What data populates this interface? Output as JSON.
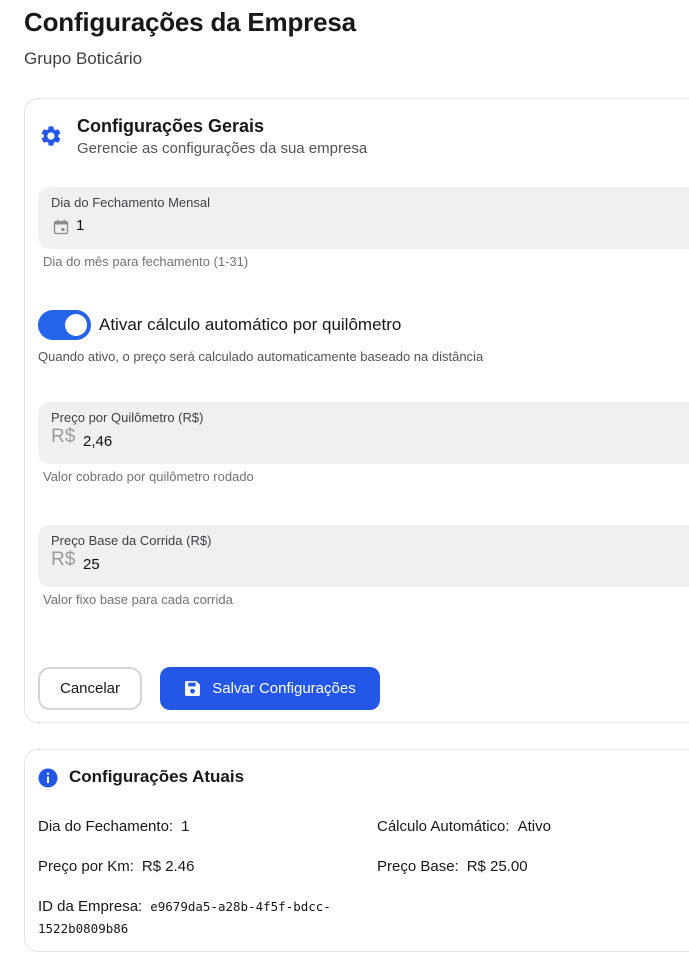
{
  "page": {
    "title": "Configurações da Empresa",
    "subtitle": "Grupo Boticário"
  },
  "general": {
    "icon": "gear-icon",
    "title": "Configurações Gerais",
    "description": "Gerencie as configurações da sua empresa",
    "closing_day": {
      "label": "Dia do Fechamento Mensal",
      "value": "1",
      "icon": "calendar-icon",
      "help": "Dia do mês para fechamento (1-31)"
    },
    "auto_calc": {
      "enabled": true,
      "label": "Ativar cálculo automático por quilômetro",
      "help": "Quando ativo, o preço será calculado automaticamente baseado na distância"
    },
    "price_per_km": {
      "label": "Preço por Quilômetro (R$)",
      "prefix": "R$",
      "value": "2,46",
      "help": "Valor cobrado por quilômetro rodado"
    },
    "base_price": {
      "label": "Preço Base da Corrida (R$)",
      "prefix": "R$",
      "value": "25",
      "help": "Valor fixo base para cada corrida"
    },
    "buttons": {
      "cancel": "Cancelar",
      "save": "Salvar Configurações"
    }
  },
  "current": {
    "icon": "info-icon",
    "title": "Configurações Atuais",
    "closing_day_label": "Dia do Fechamento:",
    "closing_day_value": "1",
    "auto_calc_label": "Cálculo Automático:",
    "auto_calc_value": "Ativo",
    "price_km_label": "Preço por Km:",
    "price_km_value": "R$ 2.46",
    "base_price_label": "Preço Base:",
    "base_price_value": "R$ 25.00",
    "company_id_label": "ID da Empresa:",
    "company_id_value_line1": "e9679da5-a28b-4f5f-bdcc-",
    "company_id_value_line2": "1522b0809b86"
  },
  "colors": {
    "accent": "#2457e8",
    "toggle_on": "#2563eb",
    "field_bg": "#f0f0f1"
  }
}
